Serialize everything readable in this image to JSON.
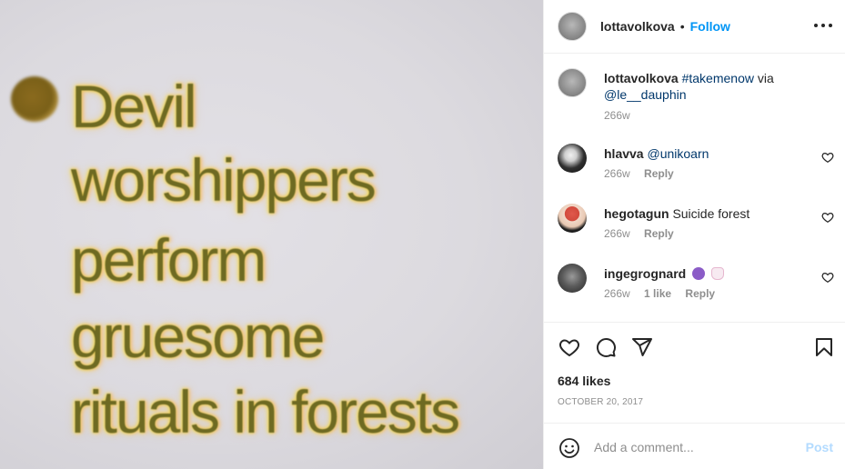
{
  "media": {
    "lines": [
      "Devil",
      "worshippers",
      "perform",
      "gruesome",
      "rituals in forests"
    ]
  },
  "header": {
    "username": "lottavolkova",
    "separator": "•",
    "follow_label": "Follow",
    "more_icon": "more-horizontal-icon"
  },
  "caption": {
    "username": "lottavolkova",
    "hashtag": "#takemenow",
    "via": "via",
    "mention": "@le__dauphin",
    "time": "266w"
  },
  "comments": [
    {
      "username": "hlavva",
      "mention": "@unikoarn",
      "text": "",
      "time": "266w",
      "likes": "",
      "reply": "Reply"
    },
    {
      "username": "hegotagun",
      "mention": "",
      "text": "Suicide forest",
      "time": "266w",
      "likes": "",
      "reply": "Reply"
    },
    {
      "username": "ingegrognard",
      "mention": "",
      "text": "",
      "emojis": [
        "purple-devil-emoji",
        "ghost-emoji"
      ],
      "time": "266w",
      "likes": "1 like",
      "reply": "Reply"
    }
  ],
  "actions": {
    "icons": [
      "heart-icon",
      "comment-icon",
      "share-icon",
      "bookmark-icon"
    ],
    "likes": "684 likes",
    "date": "OCTOBER 20, 2017"
  },
  "add_comment": {
    "placeholder": "Add a comment...",
    "post_label": "Post",
    "post_color": "#b3dbff"
  },
  "colors": {
    "link": "#0095f6",
    "mention": "#00376b",
    "muted": "#8e8e8e",
    "text": "#262626"
  }
}
